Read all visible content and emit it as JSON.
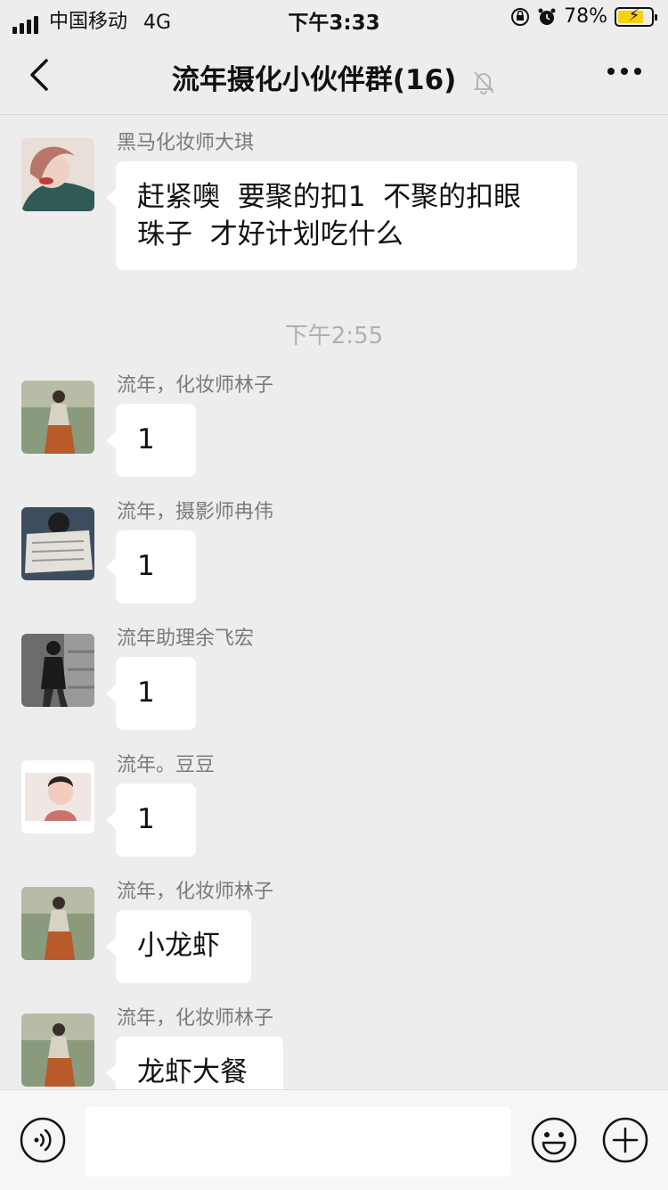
{
  "status_bar": {
    "carrier": "中国移动",
    "network": "4G",
    "time": "下午3:33",
    "battery_percent": "78%",
    "battery_level": 0.78
  },
  "header": {
    "title": "流年摄化小伙伴群(16)",
    "icons": [
      "back-arrow-icon",
      "mute-bell-icon",
      "more-icon"
    ]
  },
  "time_divider": "下午2:55",
  "messages": [
    {
      "sender": "黑马化妆师大琪",
      "text_lines": [
        "赶紧噢  要聚的扣1  不聚的扣眼",
        "珠子  才好计划吃什么"
      ]
    },
    {
      "sender": "流年，化妆师林子",
      "text": "1"
    },
    {
      "sender": "流年，摄影师冉伟",
      "text": "1"
    },
    {
      "sender": "流年助理余飞宏",
      "text": "1"
    },
    {
      "sender": "流年。豆豆",
      "text": "1"
    },
    {
      "sender": "流年，化妆师林子",
      "text": "小龙虾"
    },
    {
      "sender": "流年，化妆师林子",
      "text": "龙虾大餐"
    }
  ],
  "input_bar": {
    "icons": [
      "voice-icon",
      "emoji-icon",
      "plus-icon"
    ],
    "input_value": ""
  },
  "colors": {
    "background": "#ededed",
    "bubble": "#ffffff",
    "battery_fill": "#f5d20a"
  }
}
